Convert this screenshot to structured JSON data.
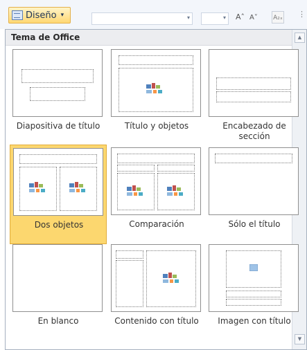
{
  "toolbar": {
    "layout_button_label": "Diseño",
    "layout_caret": "▾",
    "combo_arrow": "▾",
    "grow_font": "A˄",
    "shrink_font": "A˅",
    "clear_format": "A₂ₓ",
    "more": "⋮"
  },
  "gallery": {
    "group_title": "Tema de Office",
    "scroll_up": "▲",
    "scroll_down": "▼",
    "layouts": [
      {
        "label": "Diapositiva de título",
        "selected": false
      },
      {
        "label": "Título y objetos",
        "selected": false
      },
      {
        "label": "Encabezado de sección",
        "selected": false
      },
      {
        "label": "Dos objetos",
        "selected": true
      },
      {
        "label": "Comparación",
        "selected": false
      },
      {
        "label": "Sólo el título",
        "selected": false
      },
      {
        "label": "En blanco",
        "selected": false
      },
      {
        "label": "Contenido con título",
        "selected": false
      },
      {
        "label": "Imagen con título",
        "selected": false
      }
    ]
  },
  "colors": {
    "selected_fill": "#fcd76f",
    "selected_border": "#e1ac3a",
    "panel_border": "#a5b0bf",
    "header_bg": "#ecedf0"
  }
}
